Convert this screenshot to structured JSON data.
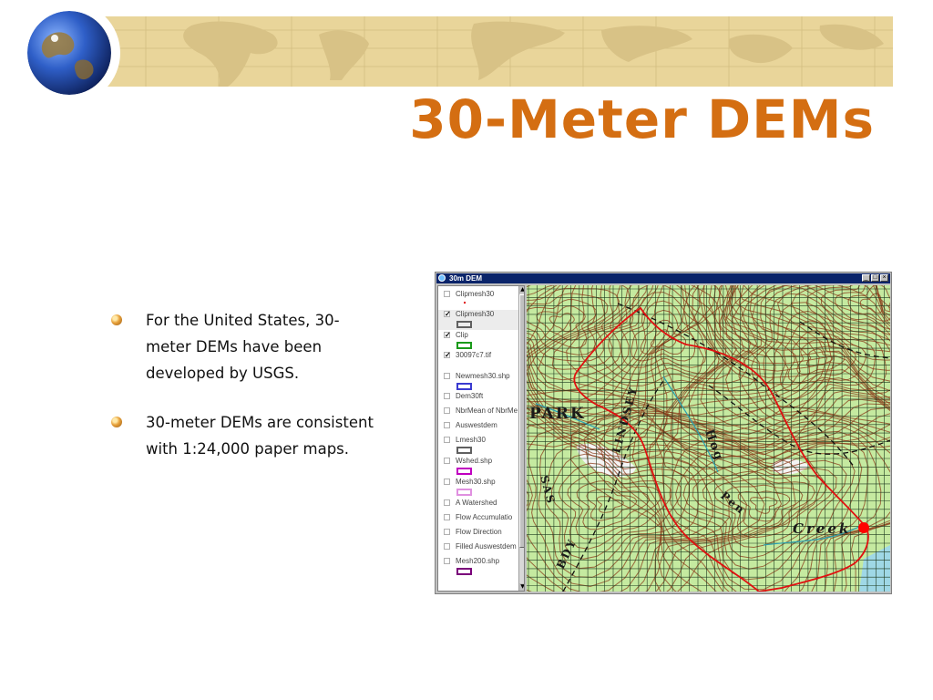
{
  "slide": {
    "title": "30-Meter DEMs",
    "bullets": [
      "For the United States, 30-meter DEMs have been developed by USGS.",
      "30-meter DEMs are consistent with 1:24,000 paper maps."
    ],
    "accent_color": "#d46e12",
    "banner_color": "#e9d59a"
  },
  "app_window": {
    "title": "30m DEM",
    "buttons": {
      "minimize": "_",
      "maximize": "□",
      "close": "×"
    },
    "layers": [
      {
        "name": "Clipmesh30",
        "checked": false,
        "legend": "dot"
      },
      {
        "name": "Clipmesh30",
        "checked": true,
        "legend": "swatch",
        "color": "#606060"
      },
      {
        "name": "Clip",
        "checked": true,
        "legend": "swatch",
        "color": "#1a9a1a"
      },
      {
        "name": "30097c7.tif",
        "checked": true,
        "legend": "none"
      },
      {
        "name": "Newmesh30.shp",
        "checked": false,
        "legend": "swatch",
        "color": "#3a3ad0"
      },
      {
        "name": "Dem30ft",
        "checked": false,
        "legend": "none"
      },
      {
        "name": "NbrMean of NbrMe",
        "checked": false,
        "legend": "none"
      },
      {
        "name": "Auswestdem",
        "checked": false,
        "legend": "none"
      },
      {
        "name": "Lmesh30",
        "checked": false,
        "legend": "swatch",
        "color": "#606060"
      },
      {
        "name": "Wshed.shp",
        "checked": false,
        "legend": "swatch",
        "color": "#c000c0"
      },
      {
        "name": "Mesh30.shp",
        "checked": false,
        "legend": "swatch",
        "color": "#e090e0"
      },
      {
        "name": "A Watershed",
        "checked": false,
        "legend": "none"
      },
      {
        "name": "Flow Accumulatio",
        "checked": false,
        "legend": "none"
      },
      {
        "name": "Flow Direction",
        "checked": false,
        "legend": "none"
      },
      {
        "name": "Filled Auswestdem",
        "checked": false,
        "legend": "none"
      },
      {
        "name": "Mesh200.shp",
        "checked": false,
        "legend": "swatch",
        "color": "#7a007a"
      }
    ],
    "map_labels": {
      "park": "PARK",
      "lindsey": "LINDSEY",
      "hog": "Hog",
      "pen": "Pen",
      "creek": "Creek",
      "sas": "SAS",
      "bdy": "BDY"
    },
    "colors": {
      "map_fill": "#c5eaa0",
      "grid": "#1f3a1f",
      "contour": "#8a3b1a",
      "watershed": "#e01010",
      "stream": "#2aa0b0"
    }
  }
}
